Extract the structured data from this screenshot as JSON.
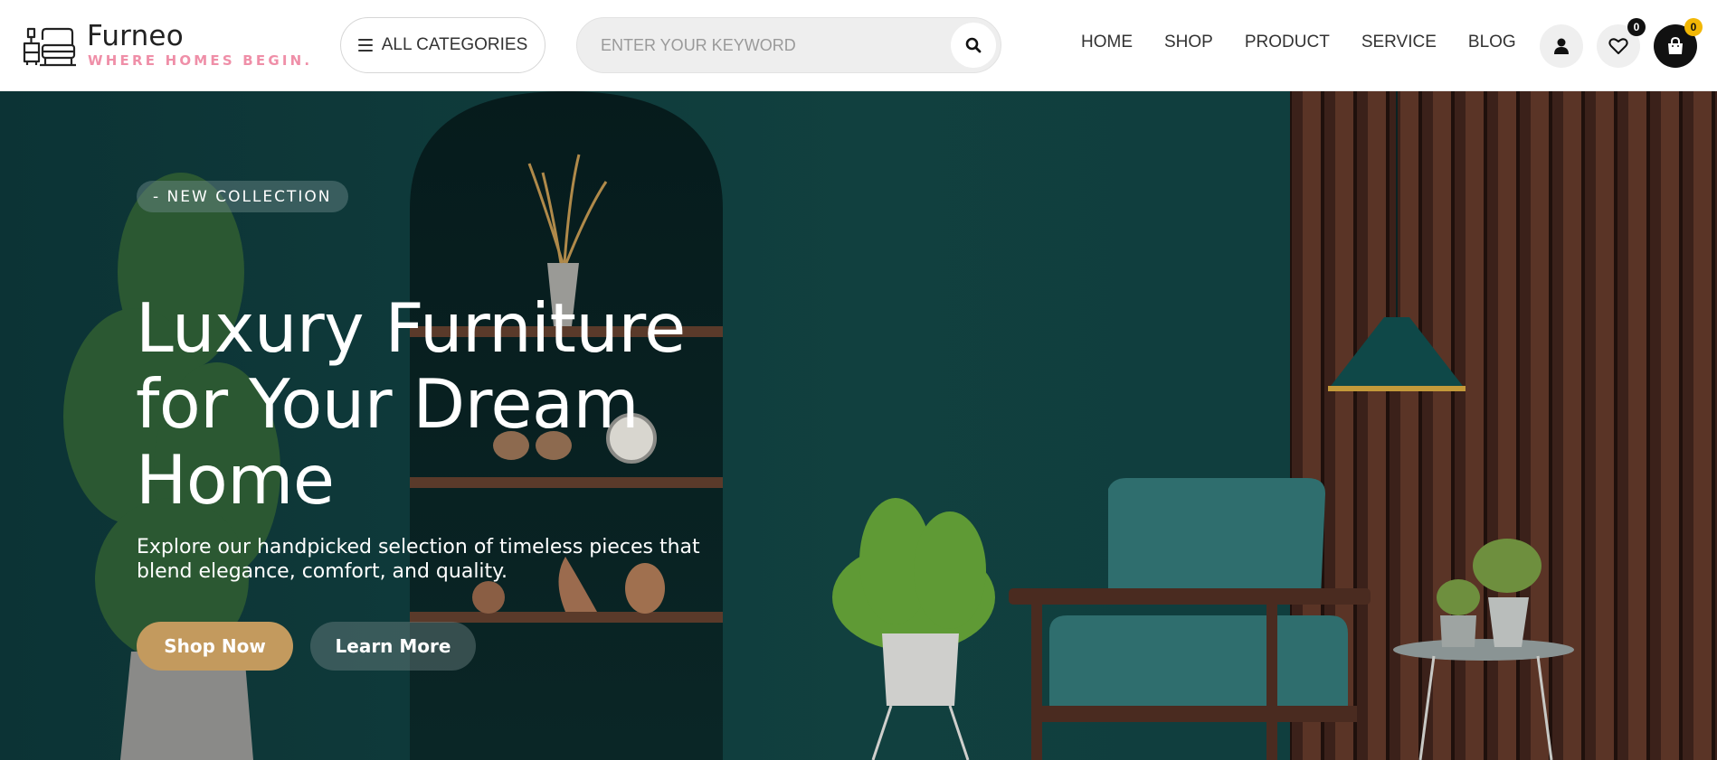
{
  "brand": {
    "name": "Furneo",
    "tagline": "WHERE HOMES BEGIN.",
    "tagline_color": "#ef8fa8"
  },
  "header": {
    "categories_label": "ALL CATEGORIES",
    "categories_icon": "hamburger-menu-icon",
    "search": {
      "placeholder": "ENTER YOUR KEYWORD",
      "value": "",
      "button_icon": "search-icon"
    },
    "nav": [
      {
        "label": "HOME"
      },
      {
        "label": "SHOP"
      },
      {
        "label": "PRODUCT"
      },
      {
        "label": "SERVICE"
      },
      {
        "label": "BLOG"
      }
    ],
    "actions": {
      "user_icon": "user-icon",
      "wishlist_icon": "heart-icon",
      "wishlist_count": "0",
      "cart_icon": "shopping-bag-icon",
      "cart_count": "0"
    }
  },
  "hero": {
    "tag": "- NEW COLLECTION",
    "title_lines": [
      "Luxury Furniture",
      "for Your Dream",
      "Home"
    ],
    "subtitle": "Explore our handpicked selection of timeless pieces that blend elegance, comfort, and quality.",
    "primary_button": "Shop Now",
    "secondary_button": "Learn More",
    "colors": {
      "background": "#0e3a3c",
      "primary_button": "#c39a5e",
      "wood": "#4a2b20",
      "armchair": "#2f6e6e"
    }
  }
}
